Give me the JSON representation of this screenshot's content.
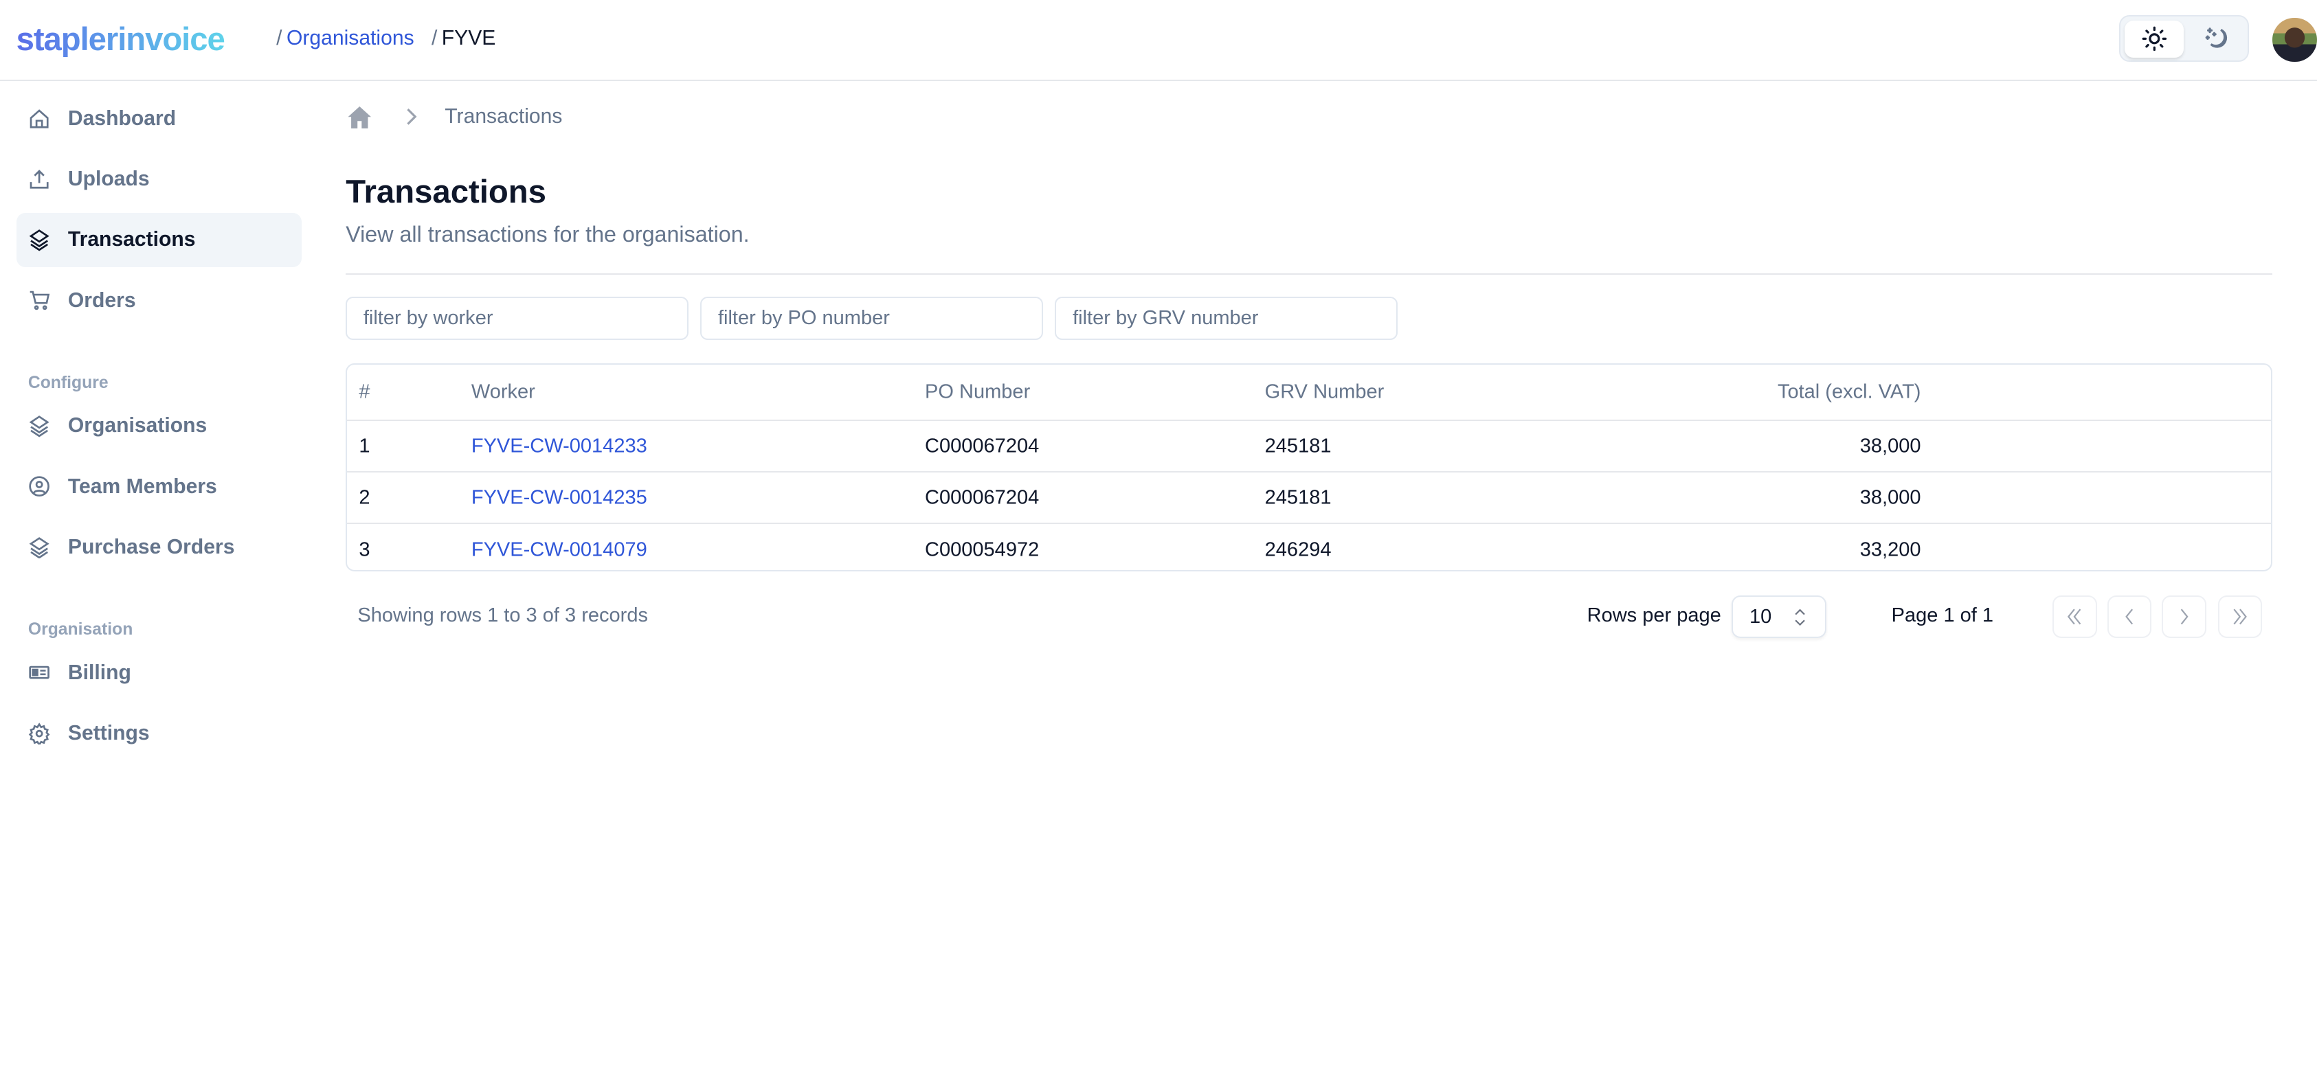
{
  "header": {
    "logo_part1": "stapler",
    "logo_part2": "invoice",
    "breadcrumb": [
      {
        "label": "Organisations"
      },
      {
        "label": "FYVE"
      }
    ],
    "separator": "/",
    "theme_options": [
      "sun-icon",
      "moon-stars-icon"
    ],
    "theme_selected": "light"
  },
  "sidebar": {
    "items": [
      {
        "label": "Dashboard",
        "icon": "home-icon"
      },
      {
        "label": "Uploads",
        "icon": "upload-icon"
      },
      {
        "label": "Transactions",
        "icon": "layers-icon",
        "active": true
      },
      {
        "label": "Orders",
        "icon": "cart-icon"
      }
    ],
    "sections": [
      {
        "title": "Configure",
        "items": [
          {
            "label": "Organisations",
            "icon": "layers-icon"
          },
          {
            "label": "Team Members",
            "icon": "user-circle-icon"
          },
          {
            "label": "Purchase Orders",
            "icon": "layers-icon"
          }
        ]
      },
      {
        "title": "Organisation",
        "items": [
          {
            "label": "Billing",
            "icon": "id-card-icon"
          },
          {
            "label": "Settings",
            "icon": "gear-icon"
          }
        ]
      }
    ]
  },
  "main": {
    "breadcrumb_current": "Transactions",
    "title": "Transactions",
    "subtitle": "View all transactions for the organisation.",
    "filters": {
      "worker_placeholder": "filter by worker",
      "po_placeholder": "filter by PO number",
      "grv_placeholder": "filter by GRV number"
    },
    "table": {
      "headers": [
        "#",
        "Worker",
        "PO Number",
        "GRV Number",
        "Total (excl. VAT)"
      ],
      "rows": [
        [
          "1",
          "FYVE-CW-0014233",
          "C000067204",
          "245181",
          "38,000"
        ],
        [
          "2",
          "FYVE-CW-0014235",
          "C000067204",
          "245181",
          "38,000"
        ],
        [
          "3",
          "FYVE-CW-0014079",
          "C000054972",
          "246294",
          "33,200"
        ]
      ]
    },
    "pagination": {
      "summary": "Showing rows 1 to 3 of 3 records",
      "rows_per_page_label": "Rows per page",
      "rows_per_page": "10",
      "page_label": "Page 1 of 1"
    }
  }
}
